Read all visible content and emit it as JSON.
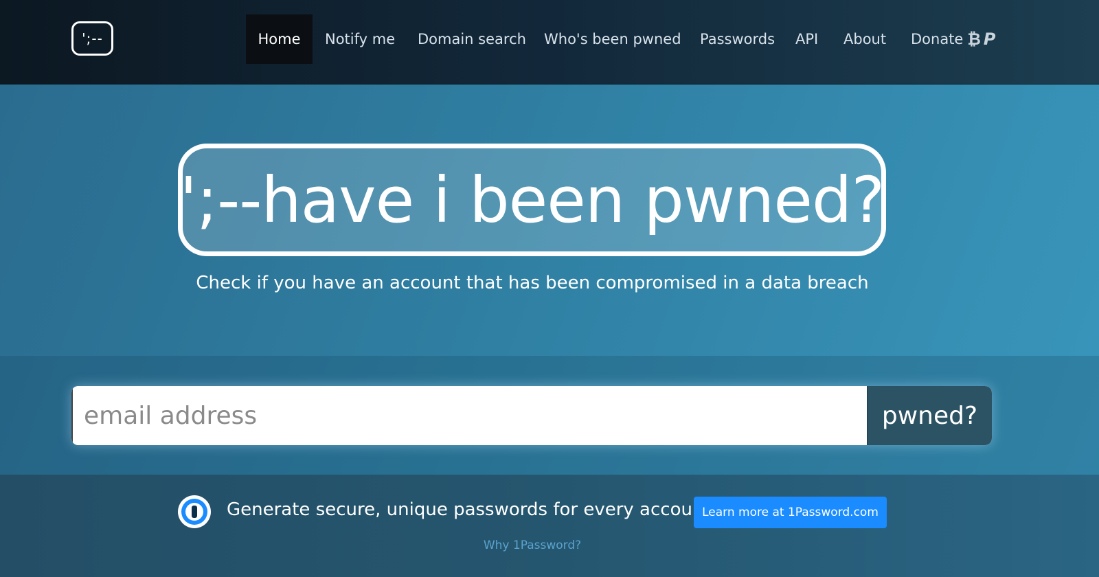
{
  "header": {
    "logo_text": "';--",
    "nav": {
      "home": "Home",
      "notify": "Notify me",
      "domain_search": "Domain search",
      "whos_been_pwned": "Who's been pwned",
      "passwords": "Passwords",
      "api": "API",
      "about": "About",
      "donate": "Donate",
      "bitcoin_glyph": "₿",
      "paypal_glyph": "P"
    }
  },
  "hero": {
    "title": "';--have i been pwned?",
    "subtitle": "Check if you have an account that has been compromised in a data breach"
  },
  "search": {
    "placeholder": "email address",
    "value": "",
    "button_label": "pwned?"
  },
  "promo": {
    "text": "Generate secure, unique passwords for every account",
    "button_label": "Learn more at 1Password.com",
    "link_label": "Why 1Password?",
    "icon": "1password-icon"
  },
  "colors": {
    "accent": "#1a8cff",
    "search_button": "#2c5364",
    "link": "#5aa3cf"
  }
}
